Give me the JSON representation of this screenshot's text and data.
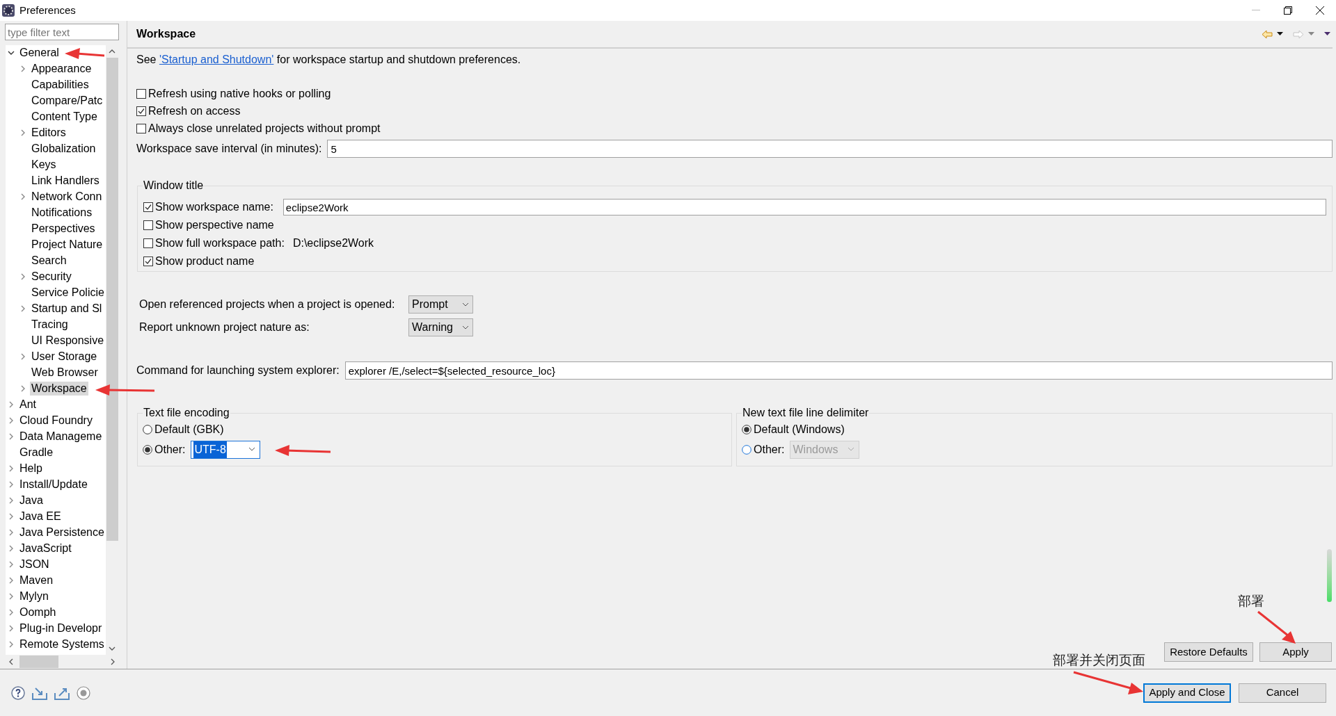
{
  "window": {
    "title": "Preferences"
  },
  "filter": {
    "placeholder": "type filter text"
  },
  "tree": [
    {
      "label": "General",
      "kind": "branch",
      "expanded": true,
      "selected": false,
      "children": [
        {
          "label": "Appearance",
          "kind": "branch",
          "selected": false
        },
        {
          "label": "Capabilities",
          "kind": "leaf",
          "selected": false
        },
        {
          "label": "Compare/Patc",
          "kind": "leaf",
          "selected": false
        },
        {
          "label": "Content Type",
          "kind": "leaf",
          "selected": false
        },
        {
          "label": "Editors",
          "kind": "branch",
          "selected": false
        },
        {
          "label": "Globalization",
          "kind": "leaf",
          "selected": false
        },
        {
          "label": "Keys",
          "kind": "leaf",
          "selected": false
        },
        {
          "label": "Link Handlers",
          "kind": "leaf",
          "selected": false
        },
        {
          "label": "Network Conn",
          "kind": "branch",
          "selected": false
        },
        {
          "label": "Notifications",
          "kind": "leaf",
          "selected": false
        },
        {
          "label": "Perspectives",
          "kind": "leaf",
          "selected": false
        },
        {
          "label": "Project Nature",
          "kind": "leaf",
          "selected": false
        },
        {
          "label": "Search",
          "kind": "leaf",
          "selected": false
        },
        {
          "label": "Security",
          "kind": "branch",
          "selected": false
        },
        {
          "label": "Service Policie",
          "kind": "leaf",
          "selected": false
        },
        {
          "label": "Startup and Sl",
          "kind": "branch",
          "selected": false
        },
        {
          "label": "Tracing",
          "kind": "leaf",
          "selected": false
        },
        {
          "label": "UI Responsive",
          "kind": "leaf",
          "selected": false
        },
        {
          "label": "User Storage",
          "kind": "branch",
          "selected": false
        },
        {
          "label": "Web Browser",
          "kind": "leaf",
          "selected": false
        },
        {
          "label": "Workspace",
          "kind": "branch",
          "selected": true
        }
      ]
    },
    {
      "label": "Ant",
      "kind": "branch",
      "selected": false
    },
    {
      "label": "Cloud Foundry",
      "kind": "branch",
      "selected": false
    },
    {
      "label": "Data Manageme",
      "kind": "branch",
      "selected": false
    },
    {
      "label": "Gradle",
      "kind": "leaf",
      "selected": false
    },
    {
      "label": "Help",
      "kind": "branch",
      "selected": false
    },
    {
      "label": "Install/Update",
      "kind": "branch",
      "selected": false
    },
    {
      "label": "Java",
      "kind": "branch",
      "selected": false
    },
    {
      "label": "Java EE",
      "kind": "branch",
      "selected": false
    },
    {
      "label": "Java Persistence",
      "kind": "branch",
      "selected": false
    },
    {
      "label": "JavaScript",
      "kind": "branch",
      "selected": false
    },
    {
      "label": "JSON",
      "kind": "branch",
      "selected": false
    },
    {
      "label": "Maven",
      "kind": "branch",
      "selected": false
    },
    {
      "label": "Mylyn",
      "kind": "branch",
      "selected": false
    },
    {
      "label": "Oomph",
      "kind": "branch",
      "selected": false
    },
    {
      "label": "Plug-in Developr",
      "kind": "branch",
      "selected": false
    },
    {
      "label": "Remote Systems",
      "kind": "branch",
      "selected": false
    }
  ],
  "page": {
    "title": "Workspace",
    "intro": {
      "before": "See",
      "link": "'Startup and Shutdown'",
      "after": "for workspace startup and shutdown preferences."
    },
    "options": [
      {
        "label": "Refresh using native hooks or polling",
        "checked": false
      },
      {
        "label": "Refresh on access",
        "checked": true
      },
      {
        "label": "Always close unrelated projects without prompt",
        "checked": false
      }
    ],
    "save_interval": {
      "label": "Workspace save interval (in minutes):",
      "value": "5"
    },
    "window_title": {
      "legend": "Window title",
      "options": [
        {
          "label": "Show workspace name:",
          "checked": true,
          "kind": "field",
          "value": "eclipse2Work"
        },
        {
          "label": "Show perspective name",
          "checked": false,
          "kind": "plain"
        },
        {
          "label": "Show full workspace path:",
          "checked": false,
          "kind": "text",
          "value": "D:\\eclipse2Work"
        },
        {
          "label": "Show product name",
          "checked": true,
          "kind": "plain"
        }
      ]
    },
    "dropdowns": [
      {
        "label": "Open referenced projects when a project is opened:",
        "value": "Prompt"
      },
      {
        "label": "Report unknown project nature as:",
        "value": "Warning"
      }
    ],
    "explorer": {
      "label": "Command for launching system explorer:",
      "value": "explorer /E,/select=${selected_resource_loc}"
    },
    "encoding": {
      "legend": "Text file encoding",
      "options": [
        {
          "label": "Default (GBK)",
          "selected": false
        },
        {
          "label": "Other:",
          "selected": true,
          "value": "UTF-8"
        }
      ]
    },
    "delimiter": {
      "legend": "New text file line delimiter",
      "options": [
        {
          "label": "Default (Windows)",
          "selected": true
        },
        {
          "label": "Other:",
          "selected": false,
          "value": "Windows"
        }
      ]
    }
  },
  "page_buttons": [
    "Restore Defaults",
    "Apply"
  ],
  "dialog_buttons": [
    {
      "label": "Apply and Close",
      "selected": true
    },
    {
      "label": "Cancel",
      "selected": false
    }
  ],
  "annotations": [
    "部署",
    "部署并关闭页面"
  ]
}
